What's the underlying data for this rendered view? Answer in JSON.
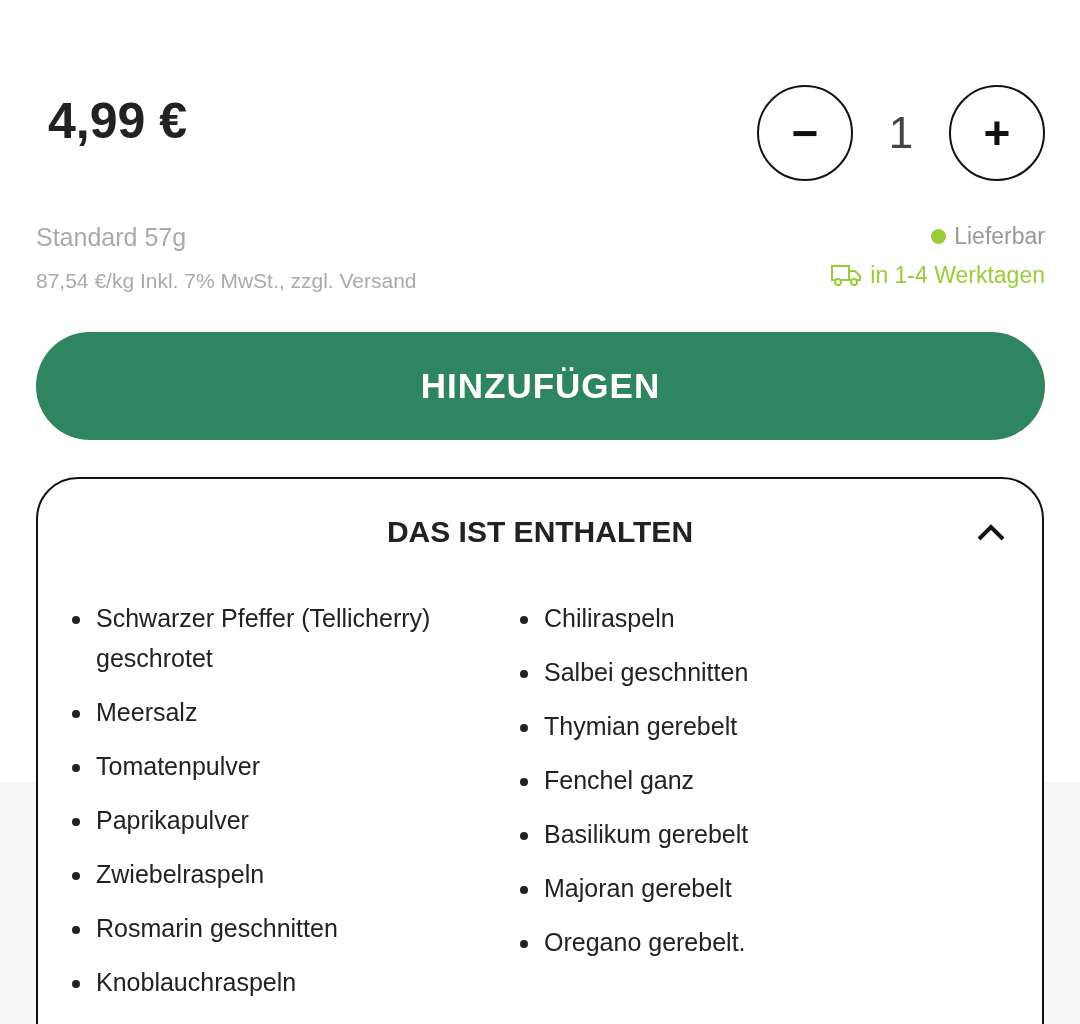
{
  "price": "4,99 €",
  "quantity": {
    "value": "1",
    "decrease": "−",
    "increase": "+"
  },
  "variant": "Standard 57g",
  "unit_price": "87,54 €/kg Inkl. 7% MwSt., zzgl. Versand",
  "availability": {
    "label": "Lieferbar",
    "available": true
  },
  "delivery": "in 1-4 Werktagen",
  "add_button": "HINZUFÜGEN",
  "ingredients": {
    "title": "DAS IST ENTHALTEN",
    "expanded": true,
    "columns": [
      [
        "Schwarzer Pfeffer (Tellicherry) geschrotet",
        "Meersalz",
        "Tomatenpulver",
        "Paprikapulver",
        "Zwiebelraspeln",
        "Rosmarin geschnitten",
        "Knoblauchraspeln"
      ],
      [
        "Chiliraspeln",
        "Salbei geschnitten",
        "Thymian gerebelt",
        "Fenchel ganz",
        "Basilikum gerebelt",
        "Majoran gerebelt",
        "Oregano gerebelt."
      ]
    ]
  }
}
